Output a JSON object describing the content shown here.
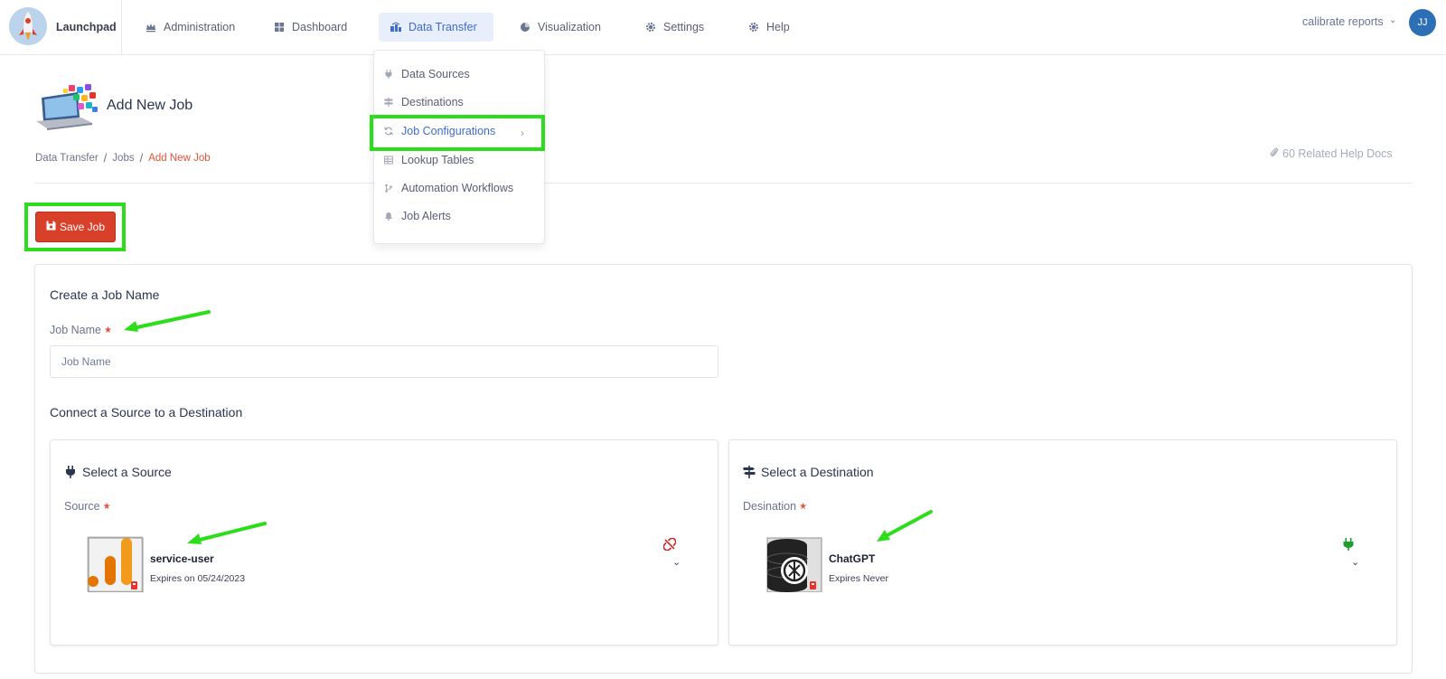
{
  "brand": {
    "name": "Launchpad"
  },
  "nav": {
    "items": [
      {
        "label": "Administration",
        "icon": "crown-icon"
      },
      {
        "label": "Dashboard",
        "icon": "grid-icon"
      },
      {
        "label": "Data Transfer",
        "icon": "transfer-icon",
        "active": true
      },
      {
        "label": "Visualization",
        "icon": "pie-chart-icon"
      },
      {
        "label": "Settings",
        "icon": "gear-icon"
      },
      {
        "label": "Help",
        "icon": "gear-icon"
      }
    ]
  },
  "user": {
    "name": "calibrate reports",
    "initials": "JJ"
  },
  "dropdown": {
    "items": [
      {
        "label": "Data Sources",
        "icon": "plug-icon"
      },
      {
        "label": "Destinations",
        "icon": "signpost-icon"
      },
      {
        "label": "Job Configurations",
        "icon": "sync-icon",
        "highlighted": true
      },
      {
        "label": "Lookup Tables",
        "icon": "table-icon"
      },
      {
        "label": "Automation Workflows",
        "icon": "branch-icon"
      },
      {
        "label": "Job Alerts",
        "icon": "bell-icon"
      }
    ]
  },
  "page": {
    "title": "Add New Job",
    "breadcrumb": [
      "Data Transfer",
      "Jobs",
      "Add New Job"
    ],
    "help_docs": "60 Related Help Docs"
  },
  "toolbar": {
    "save_label": "Save Job"
  },
  "form": {
    "job_section_title": "Create a Job Name",
    "job_name_label": "Job Name",
    "job_name_placeholder": "Job Name",
    "job_name_value": "",
    "connect_title": "Connect a Source to a Destination",
    "source": {
      "title": "Select a Source",
      "label": "Source",
      "name": "service-user",
      "expires": "Expires on 05/24/2023",
      "status": "disconnected"
    },
    "destination": {
      "title": "Select a Destination",
      "label": "Desination",
      "name": "ChatGPT",
      "expires": "Expires Never",
      "status": "connected"
    }
  },
  "colors": {
    "accent": "#3e6ccf",
    "save_button": "#d8402a",
    "highlight_outline": "#2bdd1b",
    "required_star": "#e2533b"
  }
}
